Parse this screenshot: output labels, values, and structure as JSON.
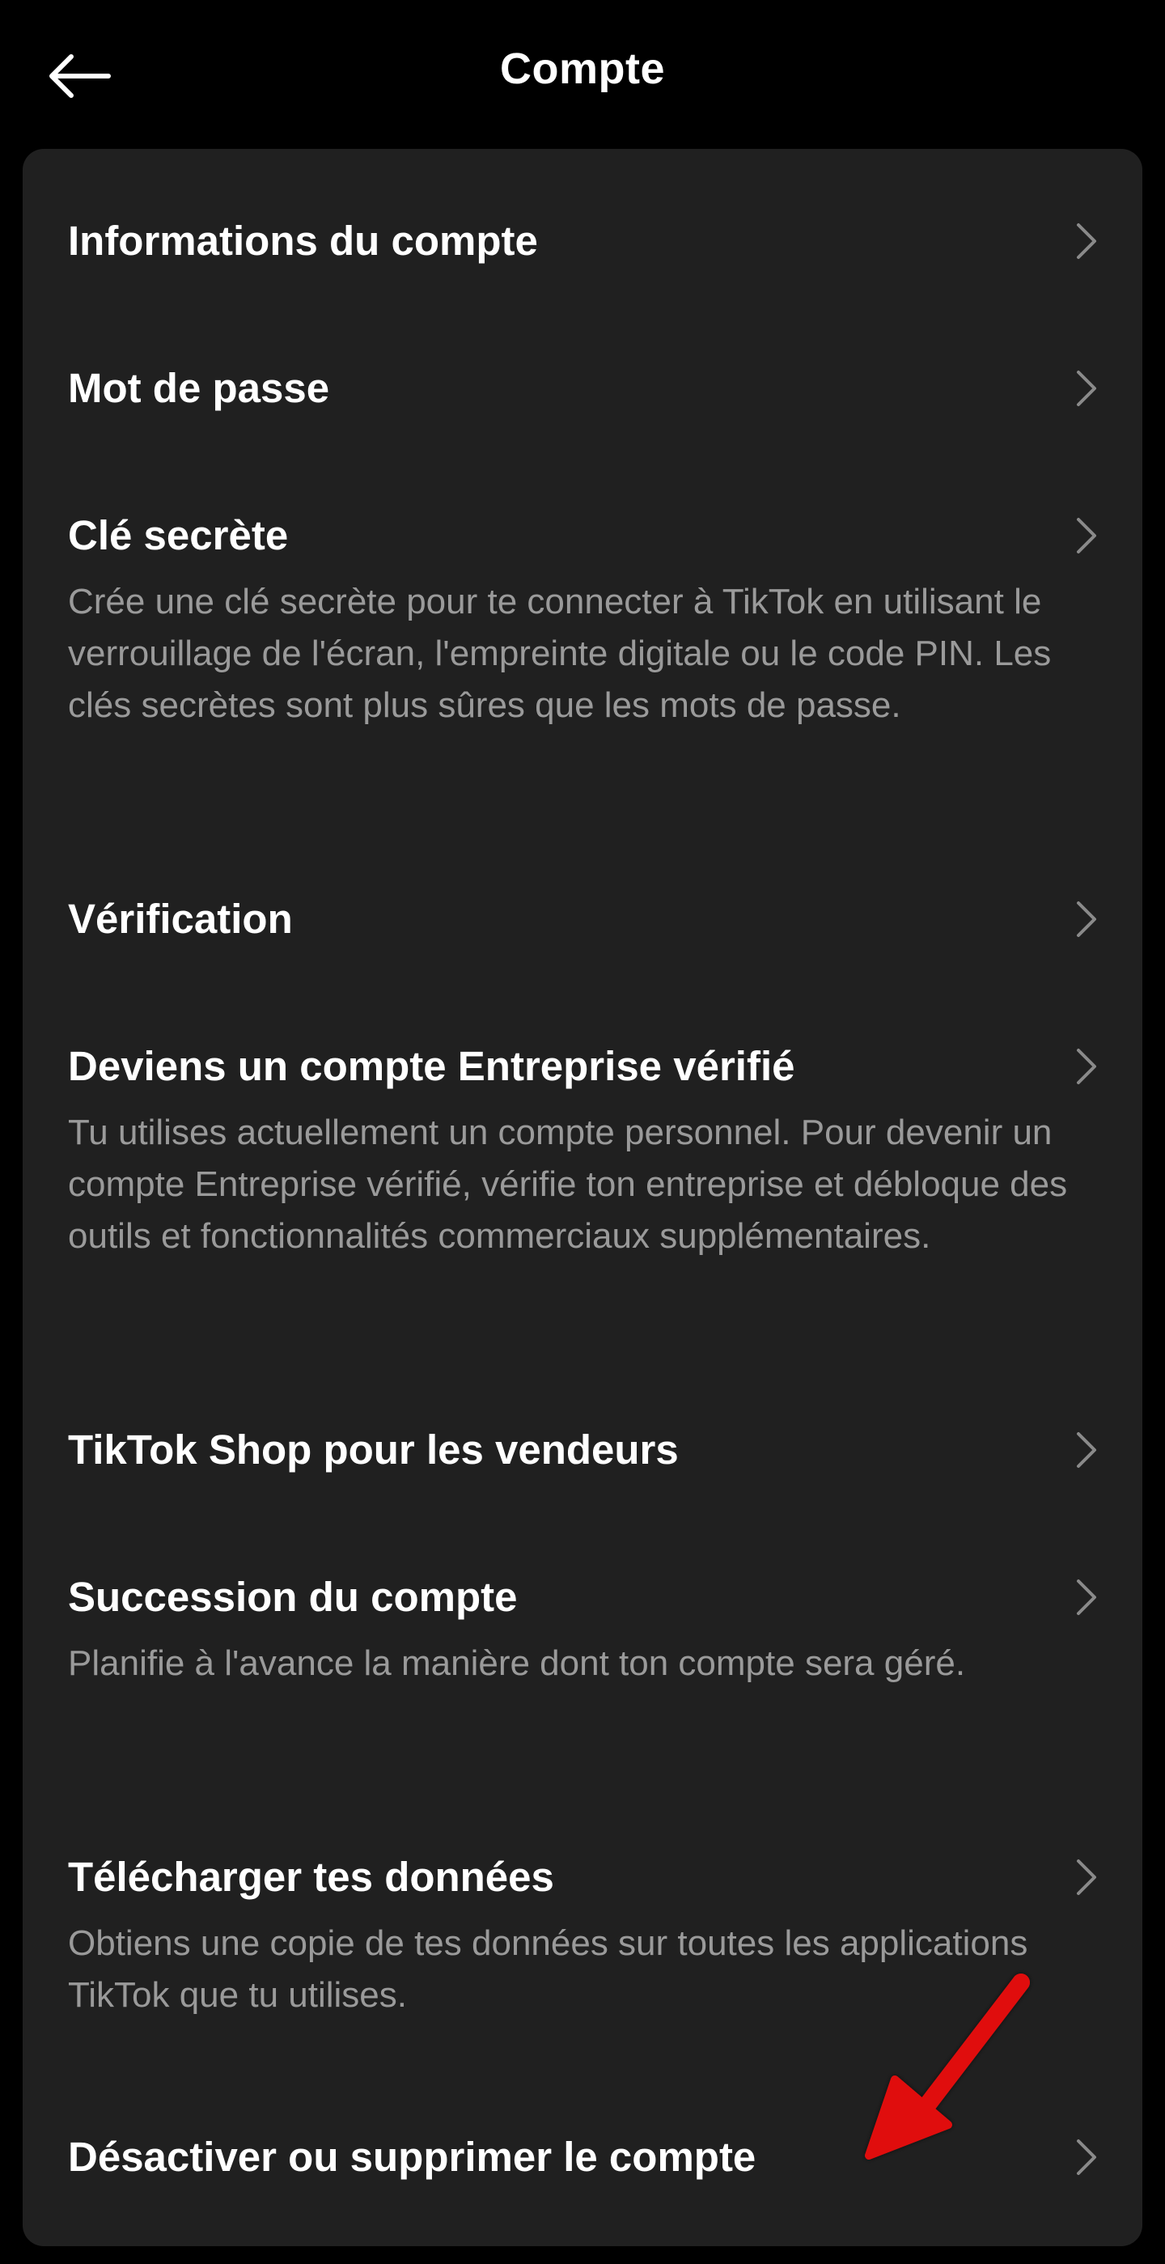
{
  "header": {
    "title": "Compte",
    "back_icon": "arrow-left-icon"
  },
  "colors": {
    "background": "#000000",
    "card": "#202020",
    "title_text": "#ffffff",
    "description_text": "#9a9a9a",
    "chevron": "#8a8a8a",
    "annotation_arrow": "#e01010"
  },
  "settings": {
    "items": [
      {
        "title": "Informations du compte",
        "description": ""
      },
      {
        "title": "Mot de passe",
        "description": ""
      },
      {
        "title": "Clé secrète",
        "description": "Crée une clé secrète pour te connecter à TikTok en utilisant le verrouillage de l'écran, l'empreinte digitale ou le code PIN. Les clés secrètes sont plus sûres que les mots de passe."
      },
      {
        "title": "Vérification",
        "description": ""
      },
      {
        "title": "Deviens un compte Entreprise vérifié",
        "description": "Tu utilises actuellement un compte personnel. Pour devenir un compte Entreprise vérifié, vérifie ton entreprise et débloque des outils et fonctionnalités commerciaux supplémentaires."
      },
      {
        "title": "TikTok Shop pour les vendeurs",
        "description": ""
      },
      {
        "title": "Succession du compte",
        "description": "Planifie à l'avance la manière dont ton compte sera géré."
      },
      {
        "title": "Télécharger tes données",
        "description": "Obtiens une copie de tes données sur toutes les applications TikTok que tu utilises."
      },
      {
        "title": "Désactiver ou supprimer le compte",
        "description": ""
      }
    ]
  }
}
